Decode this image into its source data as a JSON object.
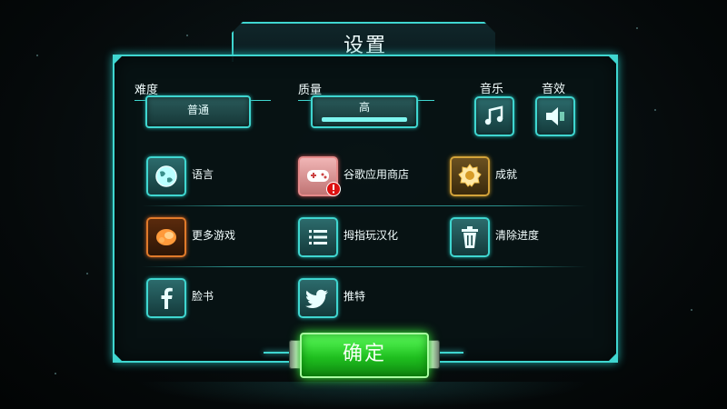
{
  "title": "设置",
  "difficulty": {
    "label": "难度",
    "value": "普通"
  },
  "quality": {
    "label": "质量",
    "value": "高",
    "level": 1.0
  },
  "music": {
    "label": "音乐",
    "icon": "music-note-icon"
  },
  "sfx": {
    "label": "音效",
    "icon": "speaker-icon"
  },
  "items": {
    "language": {
      "label": "语言",
      "icon": "globe-icon"
    },
    "google_play": {
      "label": "谷歌应用商店",
      "icon": "gamepad-alert-icon"
    },
    "achievements": {
      "label": "成就",
      "icon": "medal-icon"
    },
    "more_games": {
      "label": "更多游戏",
      "icon": "more-games-icon"
    },
    "localization": {
      "label": "拇指玩汉化",
      "icon": "list-icon"
    },
    "clear_progress": {
      "label": "清除进度",
      "icon": "trash-icon"
    },
    "facebook": {
      "label": "脸书",
      "icon": "facebook-icon"
    },
    "twitter": {
      "label": "推特",
      "icon": "twitter-icon"
    }
  },
  "confirm": {
    "label": "确定"
  },
  "colors": {
    "accent": "#3fd6d0",
    "confirm": "#22c422",
    "panel": "#08121a"
  }
}
